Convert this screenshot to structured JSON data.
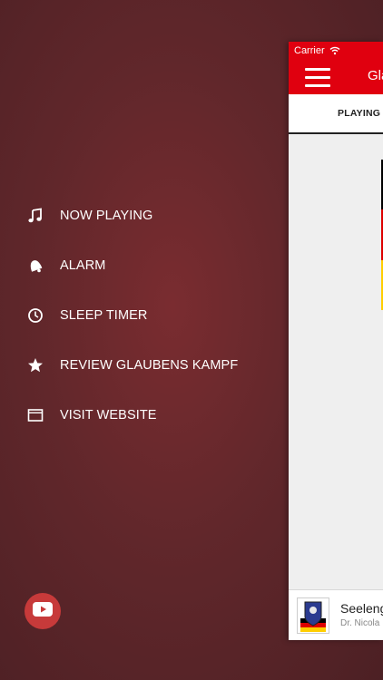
{
  "menu": {
    "items": [
      {
        "label": "NOW PLAYING",
        "icon": "music-note-icon"
      },
      {
        "label": "ALARM",
        "icon": "bell-icon"
      },
      {
        "label": "SLEEP TIMER",
        "icon": "clock-icon"
      },
      {
        "label": "REVIEW GLAUBENS KAMPF",
        "icon": "star-icon"
      },
      {
        "label": "VISIT WEBSITE",
        "icon": "browser-window-icon"
      }
    ],
    "youtube_icon": "youtube-play-icon"
  },
  "app": {
    "status": {
      "carrier": "Carrier"
    },
    "title": "Gla",
    "tab_label": "PLAYING",
    "player": {
      "title": "Seeleng",
      "subtitle": "Dr. Nicola"
    }
  },
  "colors": {
    "accent": "#e0000f",
    "menu_bg": "#61272b",
    "youtube": "#c73a3a",
    "flag": [
      "#000000",
      "#dd0000",
      "#ffce00"
    ]
  }
}
